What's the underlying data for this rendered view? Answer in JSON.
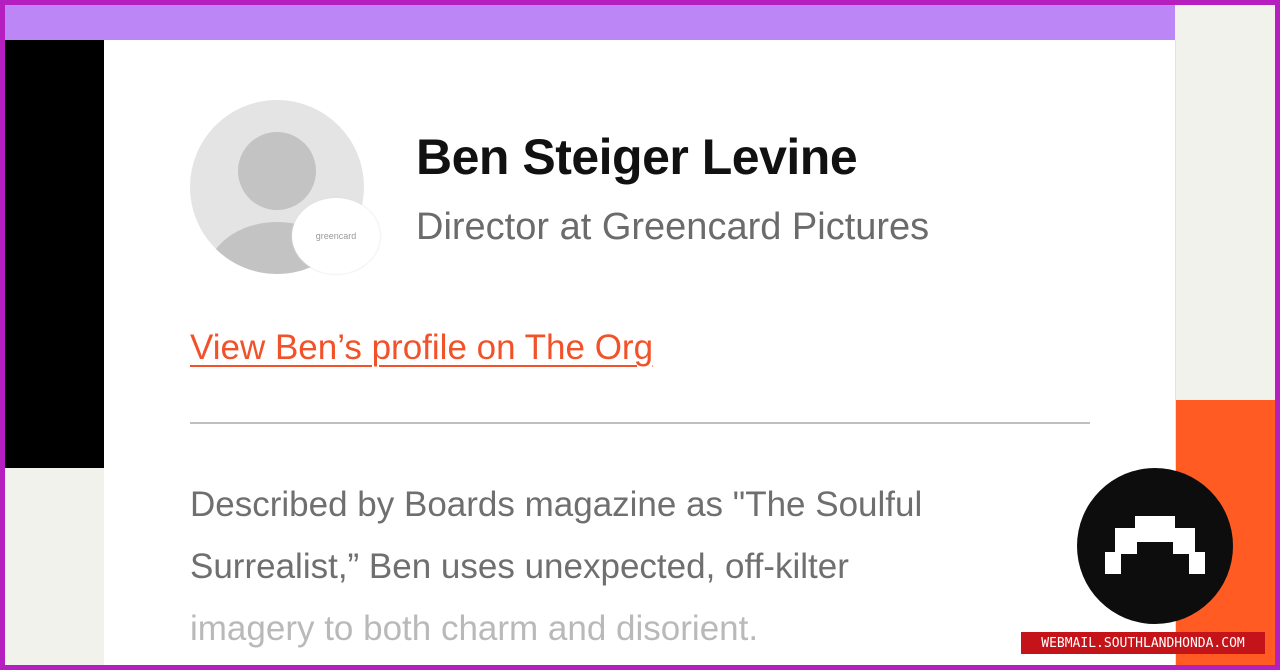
{
  "profile": {
    "name": "Ben Steiger Levine",
    "title": "Director at Greencard Pictures",
    "company_badge_text": "greencard",
    "link_text": "View Ben’s profile on The Org"
  },
  "bio": {
    "lines": [
      "Described by Boards magazine as \"The Soulful",
      "Surrealist,” Ben uses unexpected, off-kilter",
      "imagery to both charm and disorient."
    ]
  },
  "logo": {
    "icon": "the-org-logo-icon"
  },
  "watermark": {
    "text": "WEBMAIL.SOUTHLANDHONDA.COM"
  },
  "colors": {
    "frame": "#b51fbf",
    "top_bar": "#bd86f7",
    "accent_orange": "#ff5b22",
    "link": "#f2522a",
    "watermark_bg": "#c4141a"
  }
}
